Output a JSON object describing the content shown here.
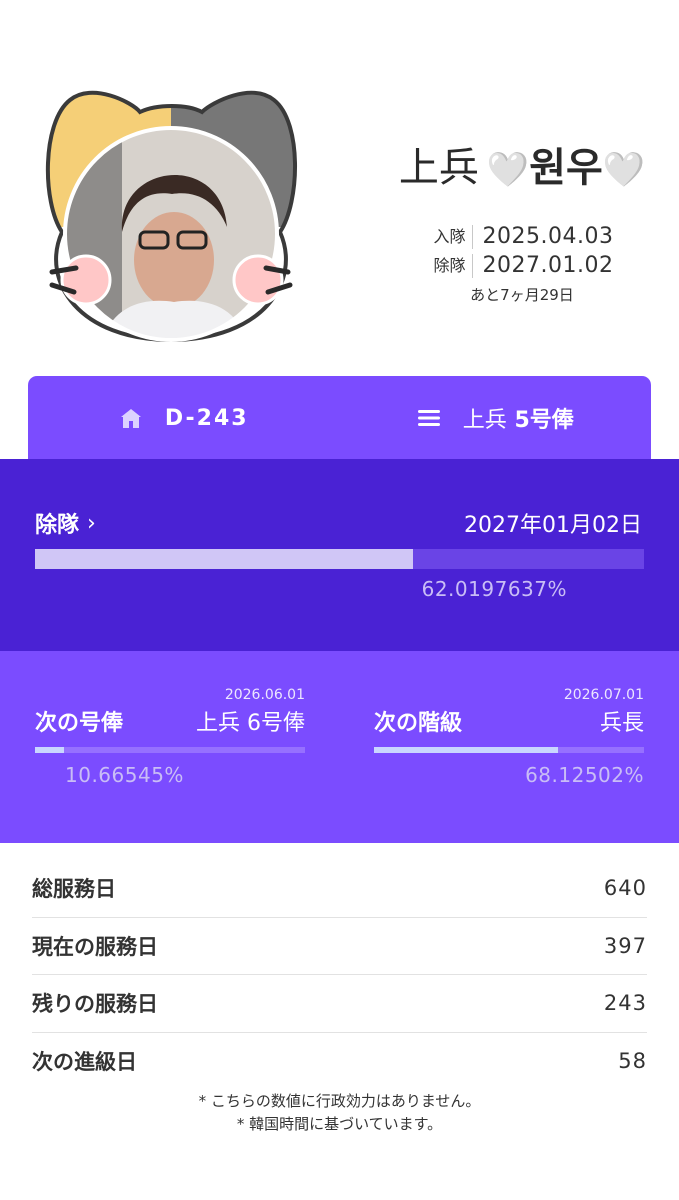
{
  "profile": {
    "rank": "上兵",
    "heart_left": "🤍",
    "nickname": "원우",
    "heart_right": "🤍",
    "enlist_label": "入隊",
    "enlist_date": "2025.04.03",
    "discharge_label": "除隊",
    "discharge_date": "2027.01.02",
    "remaining": "あと7ヶ月29日"
  },
  "tabs": {
    "dday": {
      "icon": "home-icon",
      "label": "D-243"
    },
    "pay": {
      "icon": "menu-icon",
      "rank": "上兵",
      "grade": "5号俸"
    }
  },
  "discharge": {
    "label": "除隊",
    "chevron": "›",
    "date": "2027年01月02日",
    "percent_text": "62.0197637%",
    "progress": 0.620197637
  },
  "next_pay": {
    "title": "次の号俸",
    "date": "2026.06.01",
    "value": "上兵 6号俸",
    "percent_text": "10.66545%",
    "progress": 0.1066545
  },
  "next_rank": {
    "title": "次の階級",
    "date": "2026.07.01",
    "value": "兵長",
    "percent_text": "68.12502%",
    "progress": 0.6812502
  },
  "stats": [
    {
      "label": "総服務日",
      "value": "640"
    },
    {
      "label": "現在の服務日",
      "value": "397"
    },
    {
      "label": "残りの服務日",
      "value": "243"
    },
    {
      "label": "次の進級日",
      "value": "58"
    }
  ],
  "notes": [
    "* こちらの数値に行政効力はありません。",
    "* 韓国時間に基づいています。"
  ],
  "colors": {
    "tab_purple": "#7b4cff",
    "discharge_purple": "#4a22d4",
    "cat_yellow": "#f5cf77",
    "cat_gray": "#777777",
    "cheek_pink": "#ffc7c7"
  }
}
